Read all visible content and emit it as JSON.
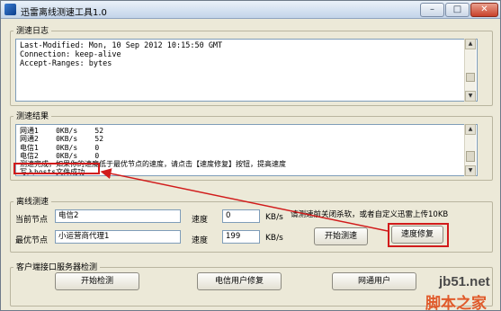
{
  "window": {
    "title": "迅雷离线测速工具1.0",
    "min_label": "–",
    "max_label": "□",
    "close_label": "✕"
  },
  "log_section": {
    "legend": "测速日志",
    "text": "Last-Modified: Mon, 10 Sep 2012 10:15:50 GMT\nConnection: keep-alive\nAccept-Ranges: bytes"
  },
  "result_section": {
    "legend": "测速结果",
    "text": "网通1    0KB/s    52\n网通2    0KB/s    52\n电信1    0KB/s    0\n电信2    0KB/s    0\n测速完成，如果你的速度低于最优节点的速度，请点击【速度修复】按钮，提高速度\n写入hosts文件成功"
  },
  "offline_section": {
    "legend": "离线测速",
    "current_node_label": "当前节点",
    "current_node_value": "电信2",
    "speed_label": "速度",
    "current_speed_value": "0",
    "unit": "KB/s",
    "best_node_label": "最优节点",
    "best_node_value": "小运营商代理1",
    "best_speed_value": "199",
    "hint": "请测速前关闭杀软，或者自定义迅雷上传10KB",
    "start_button": "开始测速",
    "repair_button": "速度修复"
  },
  "client_section": {
    "legend": "客户端接口服务器检测",
    "start_check": "开始检测",
    "telecom_repair": "电信用户修复",
    "netcom_repair": "网通用户"
  },
  "watermark": {
    "line1": "jb51.net",
    "line2": "脚本之家"
  },
  "colors": {
    "highlight": "#d11b1b",
    "arrow": "#d11b1b"
  }
}
